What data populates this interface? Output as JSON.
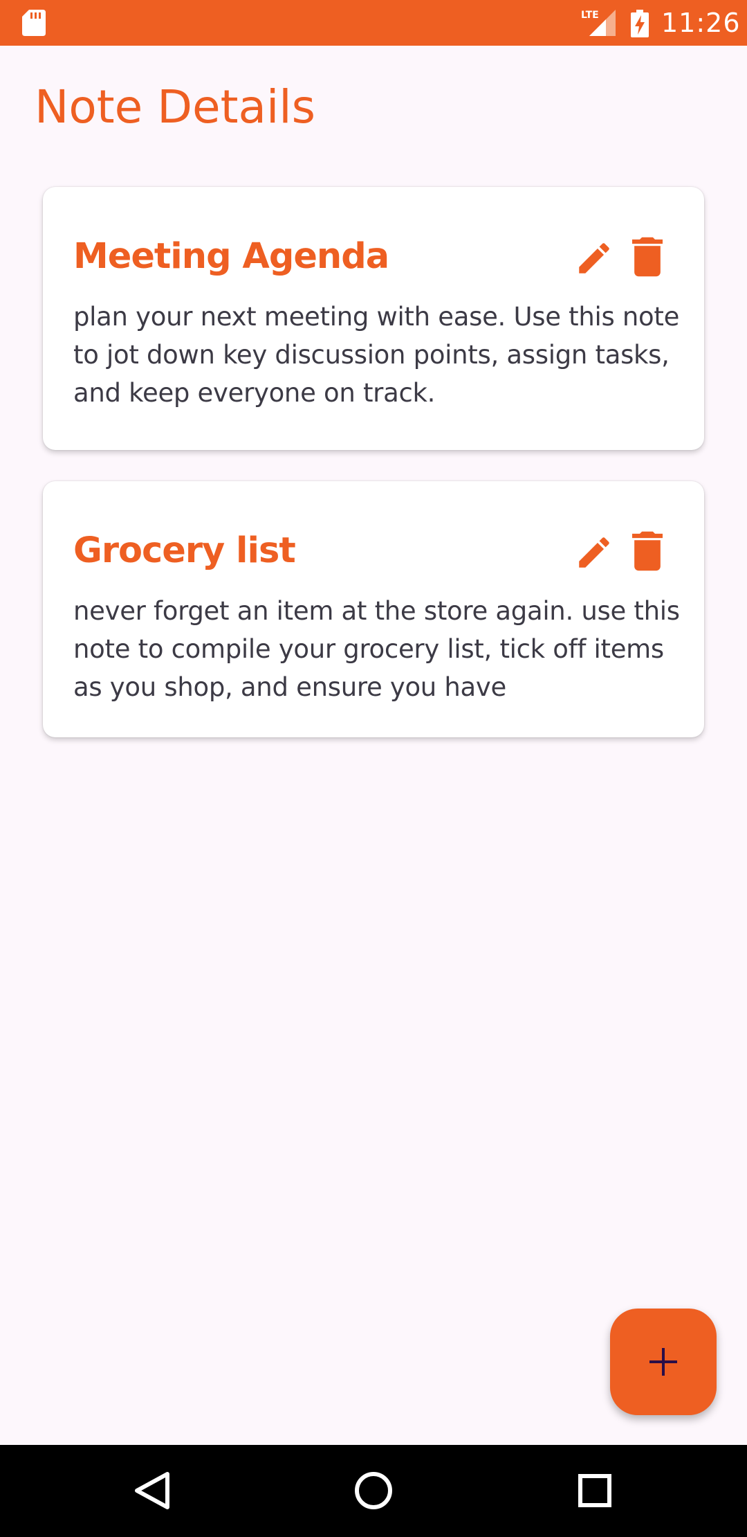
{
  "status_bar": {
    "time": "11:26",
    "network": "LTE",
    "color": "#EE5F22"
  },
  "header": {
    "title": "Note Details"
  },
  "notes": [
    {
      "title": "Meeting Agenda",
      "body": "plan your next meeting with ease. Use this note to jot down key discussion points, assign tasks, and keep everyone on track."
    },
    {
      "title": "Grocery list",
      "body": "never forget an item at the store again. use this note to compile your grocery list, tick off items as you shop, and ensure you have"
    }
  ],
  "icons": {
    "edit": "pencil-icon",
    "delete": "trash-icon",
    "add": "plus-icon"
  },
  "colors": {
    "accent": "#EE5F22",
    "background": "#FDF7FC",
    "card": "#FFFFFF",
    "body_text": "#3C3A45",
    "fab_icon": "#2A0E48"
  }
}
